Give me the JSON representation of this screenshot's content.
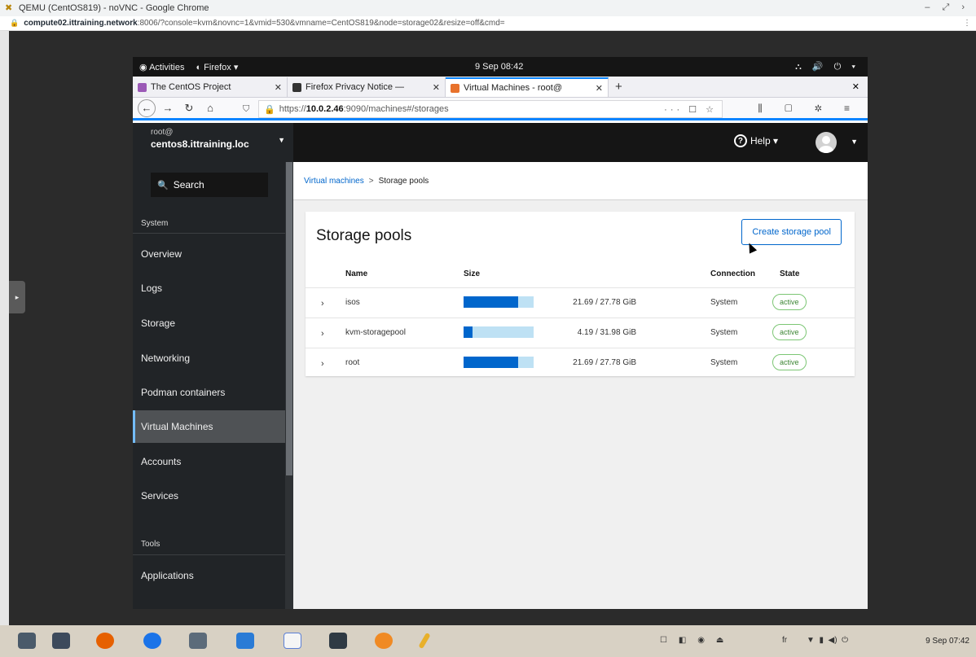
{
  "host": {
    "window_title": "QEMU (CentOS819) - noVNC - Google Chrome",
    "url_host": "compute02.ittraining.network",
    "url_rest": ":8006/?console=kvm&novnc=1&vmid=530&vmname=CentOS819&node=storage02&resize=off&cmd=",
    "taskbar_clock": "9 Sep 07:42",
    "taskbar_lang": "fr"
  },
  "gnome": {
    "activities": "Activities",
    "app_menu": "Firefox ▾",
    "clock": "9 Sep 08:42",
    "tray": "⛬ 🔊 ⏻ ▾"
  },
  "firefox": {
    "tabs": [
      {
        "label": "The CentOS Project",
        "color": "#9b59b6"
      },
      {
        "label": "Firefox Privacy Notice — ",
        "color": "#333333"
      },
      {
        "label": "Virtual Machines - root@",
        "color": "#e8722c"
      }
    ],
    "url_prefix": "https://",
    "url_host": "10.0.2.46",
    "url_rest": ":9090/machines#/storages"
  },
  "cockpit": {
    "user": "root@",
    "hostname": "centos8.ittraining.loc",
    "help_label": "Help",
    "search_placeholder": "Search",
    "nav_heading_system": "System",
    "nav_heading_tools": "Tools",
    "nav": [
      "Overview",
      "Logs",
      "Storage",
      "Networking",
      "Podman containers",
      "Virtual Machines",
      "Accounts",
      "Services"
    ],
    "nav_tools": [
      "Applications"
    ],
    "active_nav": "Virtual Machines",
    "breadcrumb": {
      "parent": "Virtual machines",
      "current": "Storage pools"
    },
    "page_title": "Storage pools",
    "create_button": "Create storage pool",
    "columns": {
      "name": "Name",
      "size": "Size",
      "connection": "Connection",
      "state": "State"
    },
    "pools": [
      {
        "name": "isos",
        "size": "21.69 / 27.78 GiB",
        "usage": 0.78,
        "connection": "System",
        "state": "active"
      },
      {
        "name": "kvm-storagepool",
        "size": "4.19 / 31.98 GiB",
        "usage": 0.13,
        "connection": "System",
        "state": "active"
      },
      {
        "name": "root",
        "size": "21.69 / 27.78 GiB",
        "usage": 0.78,
        "connection": "System",
        "state": "active"
      }
    ]
  }
}
